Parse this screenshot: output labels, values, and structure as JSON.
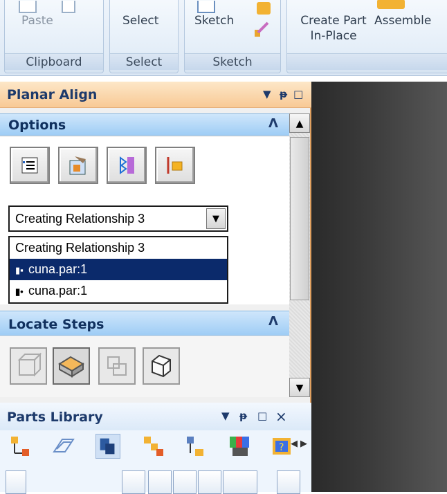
{
  "ribbon": {
    "groups": [
      {
        "label": "Clipboard",
        "button": "Paste"
      },
      {
        "label": "Select",
        "button": "Select"
      },
      {
        "label": "Sketch",
        "button": "Sketch"
      },
      {
        "label": "",
        "button": "Create Part\nIn-Place",
        "button2": "Assemble"
      }
    ],
    "create_line1": "Create Part",
    "create_line2": "In-Place",
    "assemble": "Assemble"
  },
  "panel": {
    "title": "Planar Align",
    "controls": {
      "dropdown": "▼",
      "pin": "ᵠ",
      "maximize": "□"
    },
    "options": {
      "header": "Options",
      "collapse": "⌃",
      "icons": [
        "options-icon",
        "relationship-icon",
        "flip-icon",
        "align-icon"
      ],
      "combo_value": "Creating Relationship 3",
      "list": [
        {
          "text": "Creating Relationship 3",
          "selected": false
        },
        {
          "text": "cuna.par:1",
          "selected": true
        },
        {
          "text": "cuna.par:1",
          "selected": false
        }
      ]
    },
    "locate": {
      "header": "Locate Steps",
      "collapse": "⌃",
      "icons": [
        "part-icon",
        "face-icon",
        "body-icon",
        "edge-icon"
      ],
      "active_index": 1
    }
  },
  "parts_library": {
    "title": "Parts Library",
    "controls": {
      "dropdown": "▼",
      "pin": "ᵠ",
      "maximize": "□",
      "close": "×"
    },
    "tools": [
      "tree-icon",
      "layers-icon",
      "copy-icon",
      "hierarchy-icon",
      "structure-icon",
      "palette-icon",
      "help-icon"
    ],
    "nav": {
      "left": "◀",
      "right": "▶"
    }
  }
}
